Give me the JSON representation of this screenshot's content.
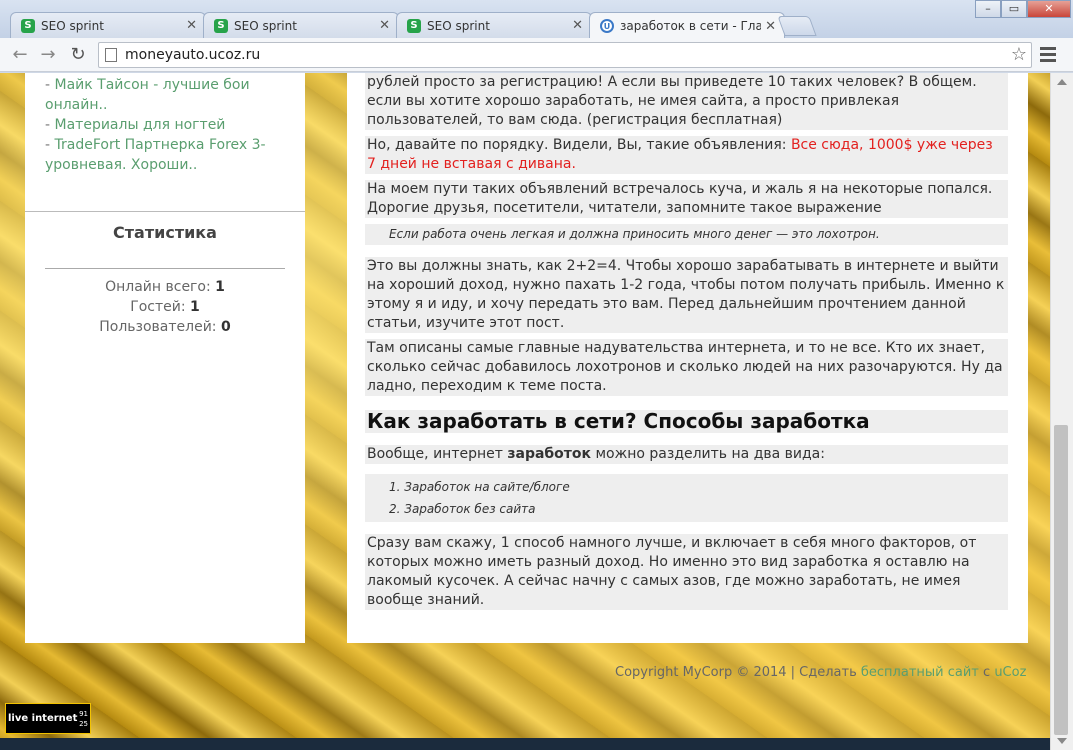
{
  "browser": {
    "tabs": [
      {
        "label": "SEO sprint"
      },
      {
        "label": "SEO sprint"
      },
      {
        "label": "SEO sprint"
      },
      {
        "label": "заработок в сети - Главн"
      }
    ],
    "tab_close": "✕",
    "url": "moneyauto.ucoz.ru",
    "win_minimize": "–",
    "win_maximize": "▭",
    "win_close": "✕",
    "back": "←",
    "forward": "→",
    "reload": "↻",
    "star": "☆"
  },
  "sidebar": {
    "links": [
      "Майк Тайсон - лучшие бои онлайн..",
      "Материалы для ногтей",
      "TradeFort Партнерка Forex 3-уровневая. Хороши.."
    ],
    "stats_title": "Статистика",
    "stats": [
      {
        "label": "Онлайн всего:",
        "value": "1"
      },
      {
        "label": "Гостей:",
        "value": "1"
      },
      {
        "label": "Пользователей:",
        "value": "0"
      }
    ]
  },
  "content": {
    "p1": "рублей просто за регистрацию! А если вы приведете 10 таких человек? В общем. если вы хотите хорошо заработать, не имея сайта, а просто привлекая пользователей, то вам сюда. (регистрация бесплатная)",
    "p2_text": "Но, давайте по порядку. Видели, Вы, такие объявления: ",
    "p2_red": "Все сюда, 1000$ уже через 7 дней не вставая с дивана.",
    "p3": "На моем пути таких объявлений встречалось куча, и жаль я на некоторые попался. Дорогие друзья, посетители, читатели, запомните такое выражение",
    "quote": "Если работа очень легкая и должна приносить много денег — это лохотрон.",
    "p4": "Это вы должны знать, как 2+2=4. Чтобы хорошо зарабатывать в интернете и выйти на хороший доход, нужно пахать 1-2 года, чтобы потом получать прибыль. Именно к этому я и иду, и хочу передать это вам. Перед дальнейшим прочтением данной статьи, изучите этот пост.",
    "p5": "Там описаны самые главные надувательства  интернета, и то не все. Кто их знает, сколько сейчас добавилось лохотронов и сколько людей на них разочаруются. Ну да ладно, переходим к теме поста.",
    "heading": "Как заработать в сети? Способы заработка",
    "p6_before": "Вообще, интернет ",
    "p6_bold": "заработок",
    "p6_after": "  можно разделить на два вида:",
    "list": [
      "1. Заработок на сайте/блоге",
      "2. Заработок без сайта"
    ],
    "p7": "Сразу вам скажу, 1 способ намного лучше, и включает в себя много факторов, от которых можно иметь разный доход. Но именно это вид заработка я оставлю на лакомый кусочек. А сейчас начну с самых азов, где можно заработать, не имея вообще знаний."
  },
  "footer": {
    "copyright": "Copyright MyCorp © 2014 | Сделать ",
    "link": "бесплатный сайт",
    "suffix": " с ",
    "brand": "uCoz"
  },
  "counter": {
    "brand": "live internet",
    "n1": "91",
    "n2": "25"
  }
}
